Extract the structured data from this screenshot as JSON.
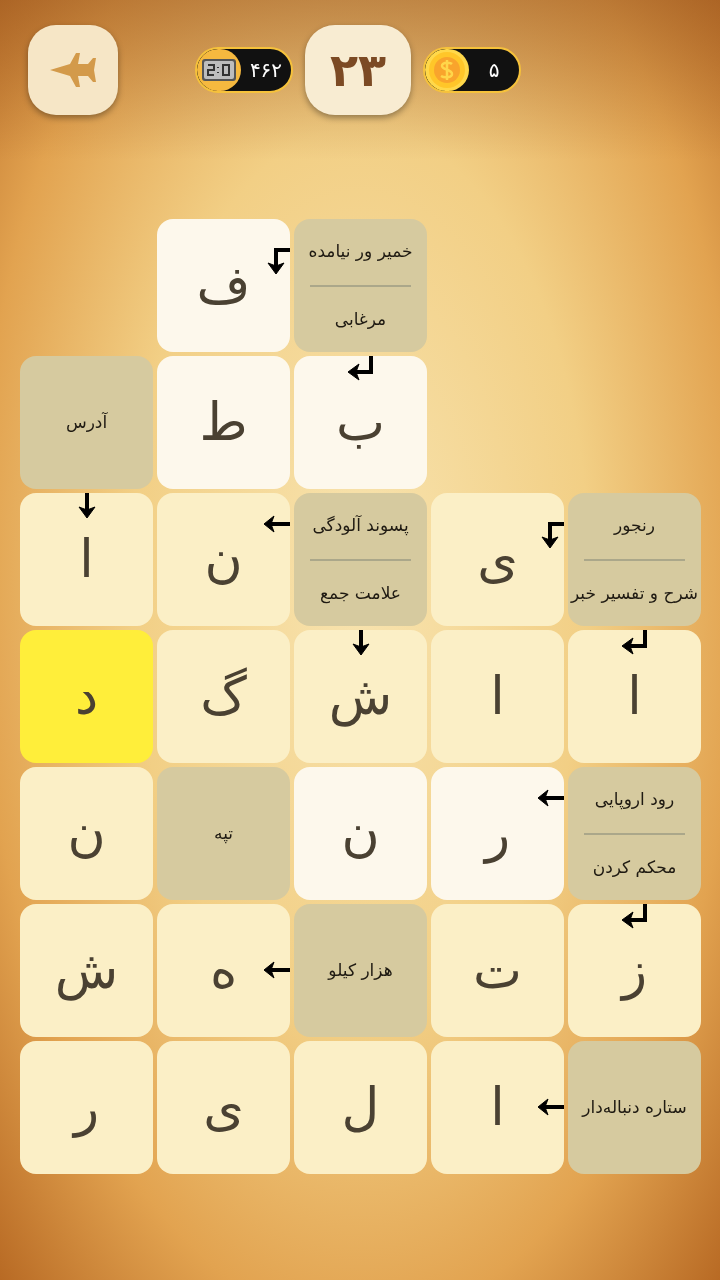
{
  "header": {
    "timer": "۴۶۲",
    "level": "۲۳",
    "coins": "۵"
  },
  "grid": [
    {
      "cells": [
        {
          "kind": "empty"
        },
        {
          "kind": "empty"
        },
        {
          "kind": "clue",
          "clues": [
            "خمیر ور نیامده",
            "مرغابی"
          ]
        },
        {
          "kind": "letter",
          "letter": "ف",
          "highlighted": true,
          "selected": false,
          "arrow": {
            "kind": "left-down"
          }
        },
        {
          "kind": "empty"
        }
      ]
    },
    {
      "cells": [
        {
          "kind": "empty"
        },
        {
          "kind": "empty"
        },
        {
          "kind": "letter",
          "letter": "ب",
          "highlighted": true,
          "selected": false,
          "arrow": {
            "kind": "down-left"
          }
        },
        {
          "kind": "letter",
          "letter": "ط",
          "highlighted": true,
          "selected": false
        },
        {
          "kind": "clue",
          "clues": [
            "آدرس"
          ]
        }
      ]
    },
    {
      "cells": [
        {
          "kind": "clue",
          "clues": [
            "رنجور",
            "شرح و تفسیر خبر"
          ]
        },
        {
          "kind": "letter",
          "letter": "ی",
          "highlighted": false,
          "selected": false,
          "arrow": {
            "kind": "left-down"
          }
        },
        {
          "kind": "clue",
          "clues": [
            "پسوند آلودگی",
            "علامت جمع"
          ]
        },
        {
          "kind": "letter",
          "letter": "ن",
          "highlighted": false,
          "selected": false,
          "arrow": {
            "kind": "left-top"
          }
        },
        {
          "kind": "letter",
          "letter": "ا",
          "highlighted": false,
          "selected": false,
          "arrow": {
            "kind": "down"
          }
        }
      ]
    },
    {
      "cells": [
        {
          "kind": "letter",
          "letter": "ا",
          "highlighted": false,
          "selected": false,
          "arrow": {
            "kind": "down-left"
          }
        },
        {
          "kind": "letter",
          "letter": "ا",
          "highlighted": false,
          "selected": false
        },
        {
          "kind": "letter",
          "letter": "ش",
          "highlighted": false,
          "selected": false,
          "arrow": {
            "kind": "down"
          }
        },
        {
          "kind": "letter",
          "letter": "گ",
          "highlighted": false,
          "selected": false
        },
        {
          "kind": "letter",
          "letter": "د",
          "selected": true
        }
      ]
    },
    {
      "cells": [
        {
          "kind": "clue",
          "clues": [
            "رود اروپایی",
            "محکم کردن"
          ]
        },
        {
          "kind": "letter",
          "letter": "ر",
          "highlighted": true,
          "selected": false,
          "arrow": {
            "kind": "left-top"
          }
        },
        {
          "kind": "letter",
          "letter": "ن",
          "highlighted": true,
          "selected": false
        },
        {
          "kind": "clue",
          "clues": [
            "تپه"
          ]
        },
        {
          "kind": "letter",
          "letter": "ن",
          "highlighted": false,
          "selected": false
        }
      ]
    },
    {
      "cells": [
        {
          "kind": "letter",
          "letter": "ز",
          "highlighted": false,
          "selected": false,
          "arrow": {
            "kind": "down-left"
          }
        },
        {
          "kind": "letter",
          "letter": "ت",
          "highlighted": false,
          "selected": false
        },
        {
          "kind": "clue",
          "clues": [
            "هزار کیلو"
          ]
        },
        {
          "kind": "letter",
          "letter": "ه",
          "highlighted": false,
          "selected": false,
          "arrow": {
            "kind": "left-middle"
          }
        },
        {
          "kind": "letter",
          "letter": "ش",
          "highlighted": false,
          "selected": false
        }
      ]
    },
    {
      "cells": [
        {
          "kind": "clue",
          "clues": [
            "ستاره دنباله‌دار"
          ]
        },
        {
          "kind": "letter",
          "letter": "ا",
          "highlighted": false,
          "selected": false,
          "arrow": {
            "kind": "left-middle"
          }
        },
        {
          "kind": "letter",
          "letter": "ل",
          "highlighted": false,
          "selected": false
        },
        {
          "kind": "letter",
          "letter": "ی",
          "highlighted": false,
          "selected": false
        },
        {
          "kind": "letter",
          "letter": "ر",
          "highlighted": false,
          "selected": false
        }
      ]
    }
  ]
}
